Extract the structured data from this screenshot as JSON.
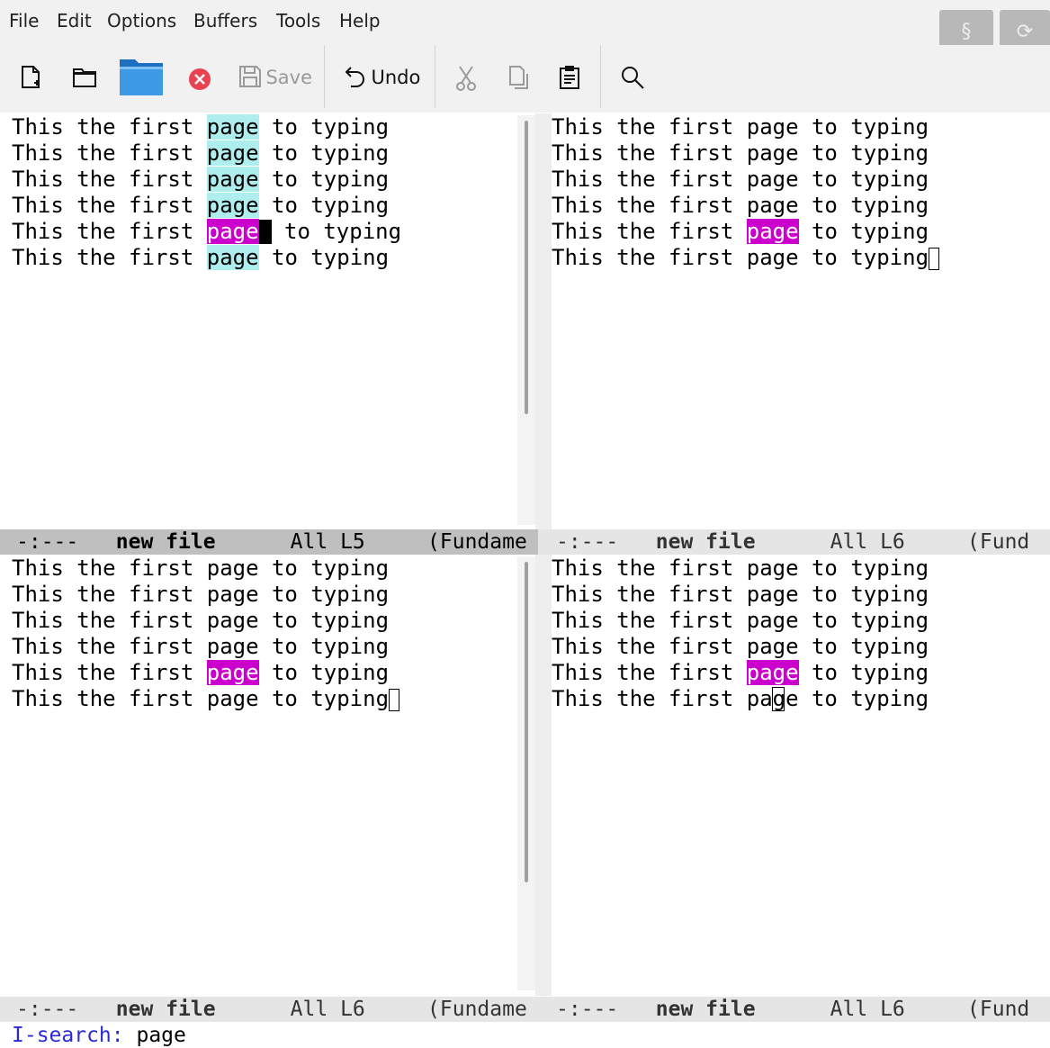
{
  "menu": {
    "items": [
      "File",
      "Edit",
      "Options",
      "Buffers",
      "Tools",
      "Help"
    ],
    "right_buttons": [
      {
        "icon": "section-icon",
        "glyph": "§"
      },
      {
        "icon": "refresh-icon",
        "glyph": "⟳"
      }
    ]
  },
  "toolbar": {
    "new_icon": "new-file-icon",
    "open_icon": "open-folder-icon",
    "dired_icon": "blue-folder-icon",
    "close_icon": "close-circle-icon",
    "save_label": "Save",
    "undo_label": "Undo",
    "cut_icon": "scissors-icon",
    "copy_icon": "copy-icon",
    "paste_icon": "paste-icon",
    "search_icon": "search-icon"
  },
  "buffer": {
    "prefix": "This the first ",
    "match": "page",
    "suffix": " to typing",
    "line": "This the first page to typing"
  },
  "windows": [
    {
      "modeline": {
        "status": "-:---",
        "name": "new file",
        "position": "All",
        "line": "L5",
        "mode": "(Fundame"
      }
    },
    {
      "modeline": {
        "status": "-:---",
        "name": "new file",
        "position": "All",
        "line": "L6",
        "mode": "(Fund"
      }
    },
    {
      "modeline": {
        "status": "-:---",
        "name": "new file",
        "position": "All",
        "line": "L6",
        "mode": "(Fundame"
      }
    },
    {
      "modeline": {
        "status": "-:---",
        "name": "new file",
        "position": "All",
        "line": "L6",
        "mode": "(Fund"
      }
    }
  ],
  "minibuffer": {
    "prompt": "I-search:",
    "query": "page"
  },
  "colors": {
    "lazy_highlight": "#afeeee",
    "current_match": "#cc00cc",
    "prompt": "#2a2ad8",
    "modeline_active": "#bfbfbf",
    "modeline_inactive": "#e5e5e5"
  }
}
